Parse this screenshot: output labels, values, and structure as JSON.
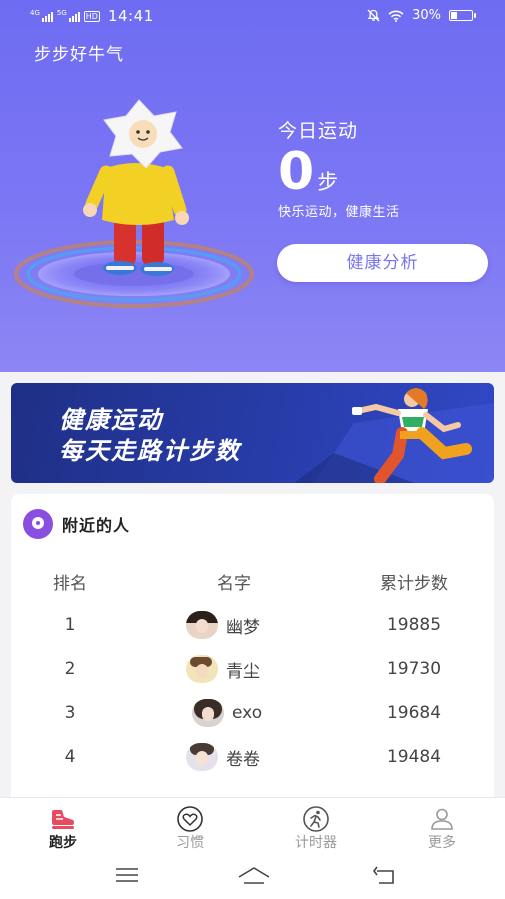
{
  "status_bar": {
    "network1": "4G",
    "network2": "5G",
    "hd": "HD",
    "time": "14:41",
    "battery": "30%",
    "battery_level": 0.3
  },
  "app": {
    "title": "步步好牛气"
  },
  "hero": {
    "today_label": "今日运动",
    "steps": "0",
    "steps_unit": "步",
    "slogan": "快乐运动，健康生活",
    "analysis_button": "健康分析"
  },
  "banner": {
    "line1": "健康运动",
    "line2": "每天走路计步数"
  },
  "nearby": {
    "title": "附近的人",
    "headers": {
      "rank": "排名",
      "name": "名字",
      "total": "累计步数"
    },
    "rows": [
      {
        "rank": "1",
        "name": "幽梦",
        "steps": "19885"
      },
      {
        "rank": "2",
        "name": "青尘",
        "steps": "19730"
      },
      {
        "rank": "3",
        "name": "exo",
        "steps": "19684"
      },
      {
        "rank": "4",
        "name": "卷卷",
        "steps": "19484"
      }
    ]
  },
  "tabs": [
    {
      "label": "跑步",
      "icon": "running-shoe-icon",
      "active": true
    },
    {
      "label": "习惯",
      "icon": "heart-icon",
      "active": false
    },
    {
      "label": "计时器",
      "icon": "runner-icon",
      "active": false
    },
    {
      "label": "更多",
      "icon": "person-icon",
      "active": false
    }
  ],
  "colors": {
    "brand": "#7a76ef",
    "accent": "#8a4fe0",
    "active_tab": "#e84a5f"
  }
}
